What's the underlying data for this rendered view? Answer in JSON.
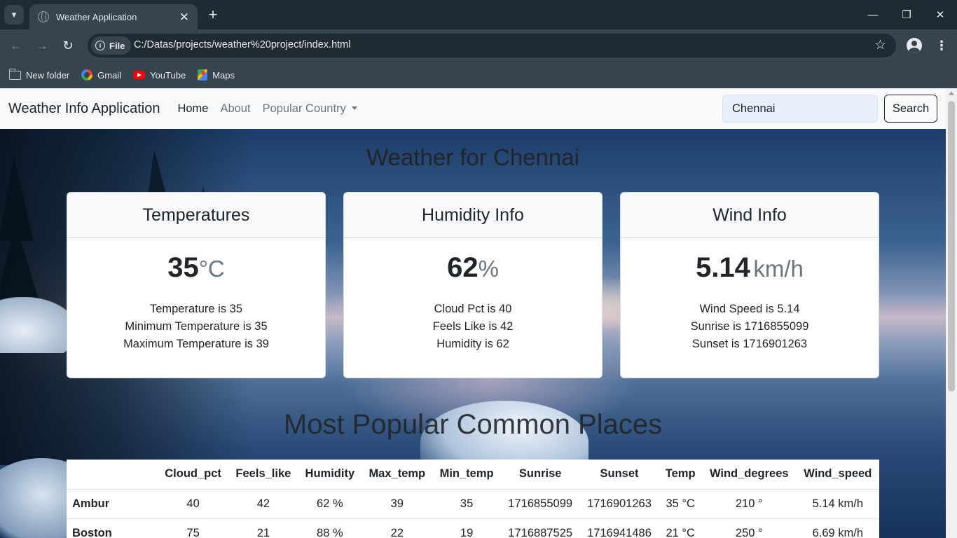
{
  "browser": {
    "tab_title": "Weather Application",
    "site_chip": "File",
    "url": "C:/Datas/projects/weather%20project/index.html",
    "bookmarks": [
      "New folder",
      "Gmail",
      "YouTube",
      "Maps"
    ]
  },
  "navbar": {
    "brand": "Weather Info Application",
    "links": {
      "home": "Home",
      "about": "About",
      "popular": "Popular Country"
    },
    "search_value": "Chennai",
    "search_button": "Search"
  },
  "heading": "Weather for Chennai",
  "cards": {
    "temperature": {
      "title": "Temperatures",
      "value": "35",
      "unit": "°C",
      "lines": [
        "Temperature is 35",
        "Minimum Temperature is 35",
        "Maximum Temperature is 39"
      ]
    },
    "humidity": {
      "title": "Humidity Info",
      "value": "62",
      "unit": "%",
      "lines": [
        "Cloud Pct is 40",
        "Feels Like is 42",
        "Humidity is 62"
      ]
    },
    "wind": {
      "title": "Wind Info",
      "value": "5.14",
      "unit": "km/h",
      "lines": [
        "Wind Speed is 5.14",
        "Sunrise is 1716855099",
        "Sunset is 1716901263"
      ]
    }
  },
  "popular": {
    "heading": "Most Popular Common Places",
    "columns": [
      "",
      "Cloud_pct",
      "Feels_like",
      "Humidity",
      "Max_temp",
      "Min_temp",
      "Sunrise",
      "Sunset",
      "Temp",
      "Wind_degrees",
      "Wind_speed"
    ],
    "rows": [
      [
        "Ambur",
        "40",
        "42",
        "62 %",
        "39",
        "35",
        "1716855099",
        "1716901263",
        "35 °C",
        "210 °",
        "5.14 km/h"
      ],
      [
        "Boston",
        "75",
        "21",
        "88 %",
        "22",
        "19",
        "1716887525",
        "1716941486",
        "21 °C",
        "250 °",
        "6.69 km/h"
      ]
    ]
  }
}
